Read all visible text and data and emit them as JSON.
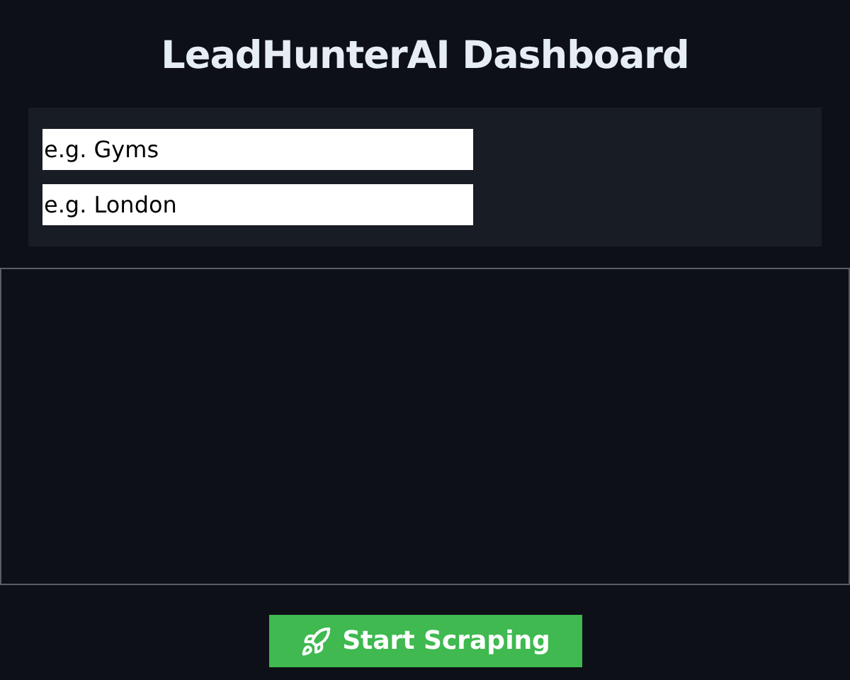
{
  "title": "LeadHunterAI Dashboard",
  "fields": [
    {
      "placeholder": "e.g. Gyms"
    },
    {
      "placeholder": "e.g. London"
    }
  ],
  "start_button": {
    "label": "Start Scraping"
  }
}
